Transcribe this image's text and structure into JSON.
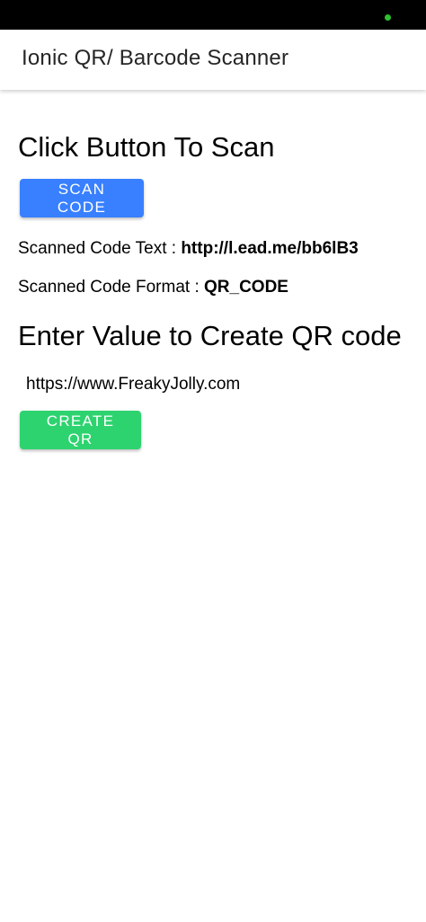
{
  "colors": {
    "status_bar": "#000000",
    "status_indicator": "#2fc02f",
    "primary_button": "#3880ff",
    "success_button": "#2dd36f"
  },
  "header": {
    "title": "Ionic QR/ Barcode Scanner"
  },
  "scan_section": {
    "heading": "Click Button To Scan",
    "button_label": "SCAN CODE",
    "text_label": "Scanned Code Text : ",
    "text_value": "http://l.ead.me/bb6lB3",
    "format_label": "Scanned Code Format : ",
    "format_value": "QR_CODE"
  },
  "create_section": {
    "heading": "Enter Value to Create QR code",
    "input_value": "https://www.FreakyJolly.com",
    "button_label": "CREATE QR"
  }
}
